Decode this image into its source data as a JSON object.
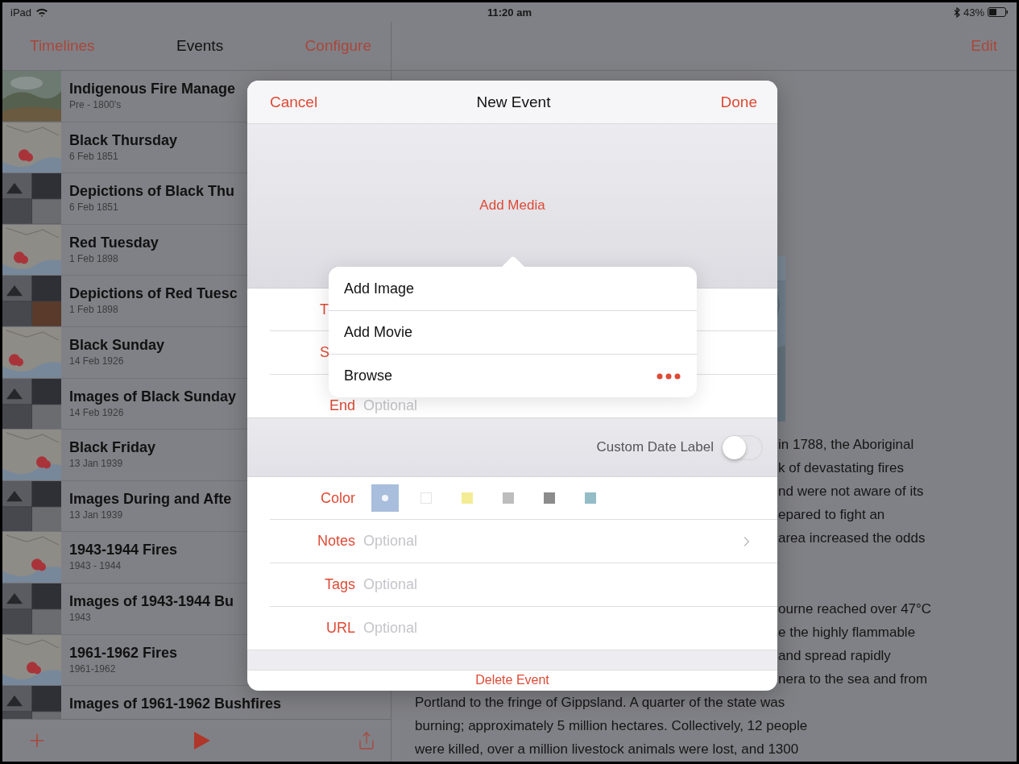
{
  "status_bar": {
    "device": "iPad",
    "time": "11:20 am",
    "battery": "43%"
  },
  "sidebar": {
    "nav": {
      "back": "Timelines",
      "title": "Events",
      "action": "Configure"
    },
    "events": [
      {
        "title": "Indigenous Fire Manage",
        "date": "Pre - 1800's"
      },
      {
        "title": "Black Thursday",
        "date": "6 Feb 1851"
      },
      {
        "title": "Depictions of Black Thu",
        "date": "6 Feb 1851"
      },
      {
        "title": "Red Tuesday",
        "date": "1 Feb 1898"
      },
      {
        "title": "Depictions of Red Tuesc",
        "date": "1 Feb 1898"
      },
      {
        "title": "Black Sunday",
        "date": "14 Feb 1926"
      },
      {
        "title": "Images of Black Sunday",
        "date": "14 Feb 1926"
      },
      {
        "title": "Black Friday",
        "date": "13 Jan 1939"
      },
      {
        "title": "Images During and Afte",
        "date": "13 Jan 1939"
      },
      {
        "title": "1943-1944 Fires",
        "date": "1943 - 1944"
      },
      {
        "title": "Images of 1943-1944 Bu",
        "date": "1943"
      },
      {
        "title": "1961-1962 Fires",
        "date": "1961-1962"
      },
      {
        "title": "Images of 1961-1962 Bushfires"
      }
    ]
  },
  "detail": {
    "nav_button": "Edit",
    "text_lines": [
      {
        "kind": "fragment",
        "text": "in 1788, the Aboriginal"
      },
      {
        "kind": "fragment",
        "text": "k of devastating fires"
      },
      {
        "kind": "fragment",
        "text": "nd were not aware of its"
      },
      {
        "kind": "fragment",
        "text": "epared to fight an"
      },
      {
        "kind": "fragment",
        "text": "area increased the odds"
      },
      {
        "kind": "gap"
      },
      {
        "kind": "fragment",
        "text": "ourne reached over 47°C"
      },
      {
        "kind": "fragment",
        "text": "e the highly flammable"
      },
      {
        "kind": "fragment",
        "text": "and spread rapidly"
      },
      {
        "kind": "fragment",
        "text": "nera to the sea and from"
      },
      {
        "kind": "full",
        "text": "Portland to the fringe of Gippsland. A quarter of the state was"
      },
      {
        "kind": "full",
        "text": "burning; approximately 5 million hectares. Collectively, 12 people"
      },
      {
        "kind": "full",
        "text": "were killed, over a million livestock animals were lost, and 1300"
      }
    ]
  },
  "dialog": {
    "cancel": "Cancel",
    "title": "New Event",
    "done": "Done",
    "add_media": "Add Media",
    "fields": [
      {
        "kind": "covered",
        "label": "T"
      },
      {
        "kind": "covered",
        "label": "S"
      },
      {
        "kind": "text",
        "label": "End",
        "placeholder": "Optional"
      }
    ],
    "custom_date": {
      "label": "Custom Date Label",
      "on": false
    },
    "color": {
      "label": "Color",
      "swatches": [
        {
          "color": "#a9bedc",
          "selected": true
        },
        {
          "color": "#ffffff",
          "selected": false
        },
        {
          "color": "#f3ec94",
          "selected": false
        },
        {
          "color": "#bdbdbd",
          "selected": false
        },
        {
          "color": "#8c8c8c",
          "selected": false
        },
        {
          "color": "#93bcc6",
          "selected": false
        }
      ]
    },
    "details": [
      {
        "kind": "link",
        "label": "Notes",
        "placeholder": "Optional"
      },
      {
        "kind": "text",
        "label": "Tags",
        "placeholder": "Optional"
      },
      {
        "kind": "text",
        "label": "URL",
        "placeholder": "Optional"
      }
    ],
    "delete": "Delete Event"
  },
  "popover": {
    "items": [
      {
        "kind": "plain",
        "label": "Add Image"
      },
      {
        "kind": "plain",
        "label": "Add Movie"
      },
      {
        "kind": "more",
        "label": "Browse"
      }
    ]
  }
}
